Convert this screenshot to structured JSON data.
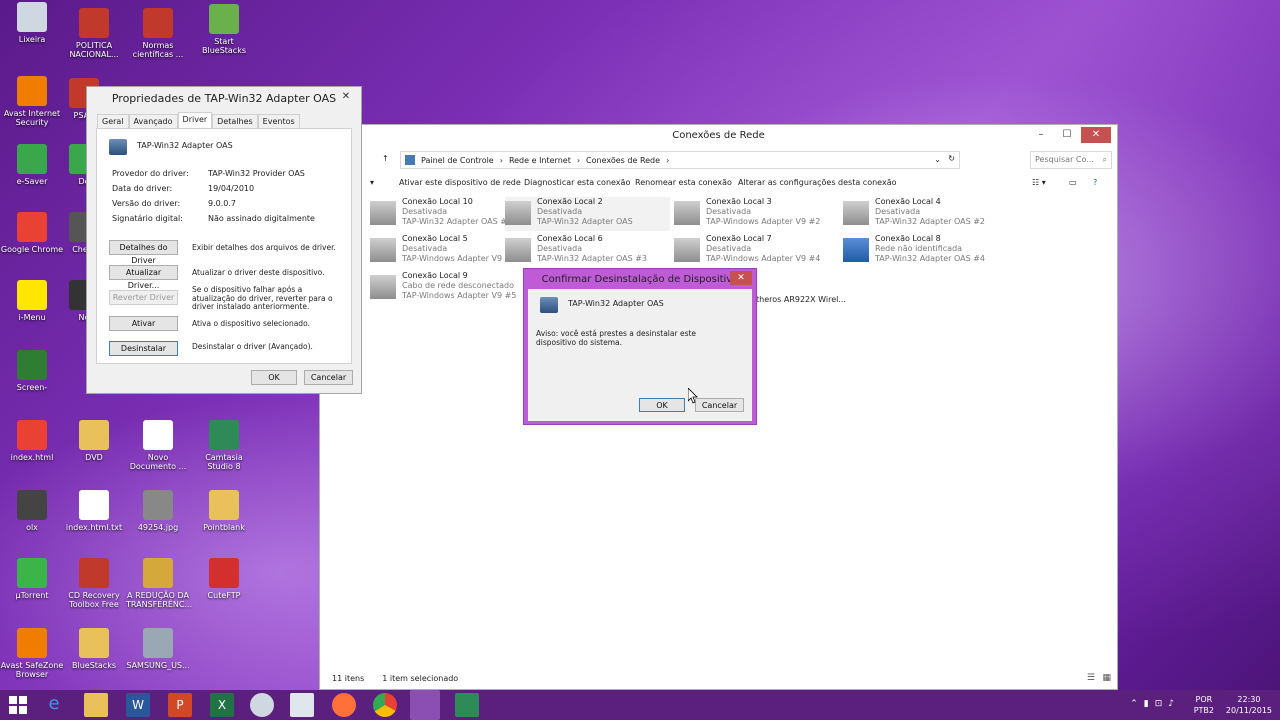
{
  "desktop_icons": [
    {
      "label": "Lixeira",
      "icon": "recycle-bin-icon",
      "color": "#cfd8e0"
    },
    {
      "label": "POLITICA NACIONAL...",
      "icon": "pdf-icon",
      "color": "#c0392b"
    },
    {
      "label": "Normas científicas ...",
      "icon": "pdf-icon",
      "color": "#c0392b"
    },
    {
      "label": "Start BlueStacks",
      "icon": "bluestacks-icon",
      "color": "#6ab04c"
    },
    {
      "label": "Avast Internet Security",
      "icon": "avast-icon",
      "color": "#f07d00"
    },
    {
      "label": "PSAC",
      "icon": "pdf-icon",
      "color": "#c0392b"
    },
    {
      "label": "e-Saver",
      "icon": "esaver-icon",
      "color": "#3aa84a"
    },
    {
      "label": "De",
      "icon": "app-icon",
      "color": "#3aa84a"
    },
    {
      "label": "Google Chrome",
      "icon": "chrome-icon",
      "color": "#e94235"
    },
    {
      "label": "Cheat",
      "icon": "app-icon",
      "color": "#555555"
    },
    {
      "label": "i-Menu",
      "icon": "smiley-icon",
      "color": "#ffe600"
    },
    {
      "label": "Ne",
      "icon": "app-icon",
      "color": "#333333"
    },
    {
      "label": "Screen-",
      "icon": "calculator-icon",
      "color": "#2e7d32"
    },
    {
      "label": "index.html",
      "icon": "chrome-icon",
      "color": "#e94235"
    },
    {
      "label": "DVD",
      "icon": "folder-icon",
      "color": "#e8c15a"
    },
    {
      "label": "Novo Documento ...",
      "icon": "document-icon",
      "color": "#ffffff"
    },
    {
      "label": "Camtasia Studio 8",
      "icon": "camtasia-icon",
      "color": "#2e8b57"
    },
    {
      "label": "olx",
      "icon": "file-icon",
      "color": "#444444"
    },
    {
      "label": "index.html.txt",
      "icon": "text-file-icon",
      "color": "#ffffff"
    },
    {
      "label": "49254.jpg",
      "icon": "image-icon",
      "color": "#888888"
    },
    {
      "label": "Pointblank",
      "icon": "folder-icon",
      "color": "#e8c15a"
    },
    {
      "label": "µTorrent",
      "icon": "utorrent-icon",
      "color": "#3bb54a"
    },
    {
      "label": "CD Recovery Toolbox Free",
      "icon": "cd-icon",
      "color": "#c0392b"
    },
    {
      "label": "A REDUÇÃO DA TRANSFERÊNC...",
      "icon": "archive-icon",
      "color": "#d4a83a"
    },
    {
      "label": "CuteFTP",
      "icon": "ftp-icon",
      "color": "#d32f2f"
    },
    {
      "label": "Avast SafeZone Browser",
      "icon": "avast-icon",
      "color": "#f07d00"
    },
    {
      "label": "BlueStacks",
      "icon": "folder-icon",
      "color": "#e8c15a"
    },
    {
      "label": "SAMSUNG_US...",
      "icon": "installer-icon",
      "color": "#9aa7b5"
    }
  ],
  "explorer": {
    "title": "Conexões de Rede",
    "breadcrumb": [
      "Painel de Controle",
      "Rede e Internet",
      "Conexões de Rede"
    ],
    "search_placeholder": "Pesquisar Co...",
    "commands": [
      "Ativar este dispositivo de rede",
      "Diagnosticar esta conexão",
      "Renomear esta conexão",
      "Alterar as configurações desta conexão"
    ],
    "connections": [
      {
        "name": "Conexão Local 10",
        "status": "Desativada",
        "adapter": "TAP-Win32 Adapter OAS #5"
      },
      {
        "name": "Conexão Local 2",
        "status": "Desativada",
        "adapter": "TAP-Win32 Adapter OAS"
      },
      {
        "name": "Conexão Local 3",
        "status": "Desativada",
        "adapter": "TAP-Windows Adapter V9 #2"
      },
      {
        "name": "Conexão Local 4",
        "status": "Desativada",
        "adapter": "TAP-Win32 Adapter OAS #2"
      },
      {
        "name": "Conexão Local 5",
        "status": "Desativada",
        "adapter": "TAP-Windows Adapter V9 #3"
      },
      {
        "name": "Conexão Local 6",
        "status": "Desativada",
        "adapter": "TAP-Win32 Adapter OAS #3"
      },
      {
        "name": "Conexão Local 7",
        "status": "Desativada",
        "adapter": "TAP-Windows Adapter V9 #4"
      },
      {
        "name": "Conexão Local 8",
        "status": "Rede não identificada",
        "adapter": "TAP-Win32 Adapter OAS #4"
      },
      {
        "name": "Conexão Local 9",
        "status": "Cabo de rede desconectado",
        "adapter": "TAP-Windows Adapter V9 #5"
      }
    ],
    "partial_wireless": "theros AR922X Wirel...",
    "status_items": "11 itens",
    "status_selected": "1 item selecionado"
  },
  "props": {
    "title": "Propriedades de TAP-Win32 Adapter OAS",
    "tabs": [
      "Geral",
      "Avançado",
      "Driver",
      "Detalhes",
      "Eventos"
    ],
    "device_name": "TAP-Win32 Adapter OAS",
    "fields": [
      {
        "label": "Provedor do driver:",
        "value": "TAP-Win32 Provider OAS"
      },
      {
        "label": "Data do driver:",
        "value": "19/04/2010"
      },
      {
        "label": "Versão do driver:",
        "value": "9.0.0.7"
      },
      {
        "label": "Signatário digital:",
        "value": "Não assinado digitalmente"
      }
    ],
    "buttons": [
      {
        "label": "Detalhes do Driver",
        "desc": "Exibir detalhes dos arquivos de driver."
      },
      {
        "label": "Atualizar Driver...",
        "desc": "Atualizar o driver deste dispositivo."
      },
      {
        "label": "Reverter Driver",
        "desc": "Se o dispositivo falhar após a atualização do driver, reverter para o driver instalado anteriormente."
      },
      {
        "label": "Ativar",
        "desc": "Ativa o dispositivo selecionado."
      },
      {
        "label": "Desinstalar",
        "desc": "Desinstalar o driver (Avançado)."
      }
    ],
    "ok": "OK",
    "cancel": "Cancelar"
  },
  "confirm": {
    "title": "Confirmar Desinstalação de Dispositivo",
    "device_name": "TAP-Win32 Adapter OAS",
    "warning": "Aviso: você está prestes a desinstalar este dispositivo do sistema.",
    "ok": "OK",
    "cancel": "Cancelar"
  },
  "tray": {
    "lang1": "POR",
    "lang2": "PTB2",
    "time": "22:30",
    "date": "20/11/2015"
  },
  "colors": {
    "accent": "#c05bd8",
    "taskbar": "#5b1f7e"
  }
}
